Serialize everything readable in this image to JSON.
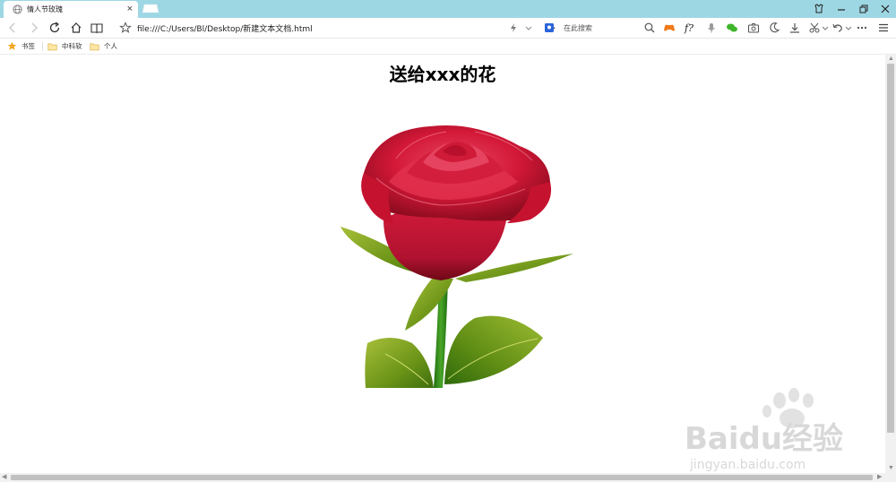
{
  "tab": {
    "title": "情人节玫瑰",
    "close": "×"
  },
  "navbar": {
    "url": "file:///C:/Users/Bl/Desktop/新建文本文档.html",
    "search_placeholder": "在此搜索"
  },
  "bookmarks": [
    {
      "label": "书签",
      "icon": "star-icon"
    },
    {
      "label": "中科软",
      "icon": "folder-icon"
    },
    {
      "label": "个人",
      "icon": "folder-icon"
    }
  ],
  "page": {
    "heading": "送给xxx的花"
  },
  "watermark": {
    "brand": "Baidu经验",
    "domain": "jingyan.baidu.com"
  },
  "colors": {
    "tabbar": "#9ed7e4",
    "petal": "#d8183a",
    "petal_dark": "#8e0c20",
    "leaf": "#6f9a18",
    "stem": "#2f8a1a"
  }
}
